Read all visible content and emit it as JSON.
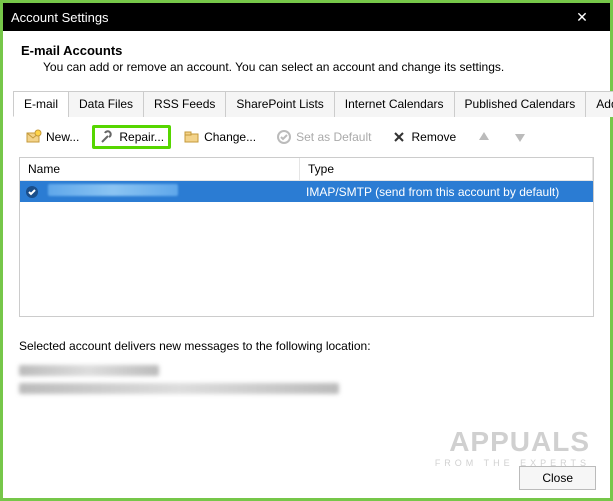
{
  "titlebar": {
    "title": "Account Settings"
  },
  "header": {
    "title": "E-mail Accounts",
    "desc": "You can add or remove an account. You can select an account and change its settings."
  },
  "tabs": [
    {
      "label": "E-mail",
      "active": true
    },
    {
      "label": "Data Files"
    },
    {
      "label": "RSS Feeds"
    },
    {
      "label": "SharePoint Lists"
    },
    {
      "label": "Internet Calendars"
    },
    {
      "label": "Published Calendars"
    },
    {
      "label": "Address Books"
    }
  ],
  "toolbar": {
    "new": "New...",
    "repair": "Repair...",
    "change": "Change...",
    "set_default": "Set as Default",
    "remove": "Remove"
  },
  "list": {
    "col_name": "Name",
    "col_type": "Type",
    "row0_type": "IMAP/SMTP (send from this account by default)"
  },
  "footer": {
    "msg": "Selected account delivers new messages to the following location:",
    "close": "Close"
  },
  "watermark": {
    "big": "APPUALS",
    "small": "FROM THE EXPERTS"
  }
}
